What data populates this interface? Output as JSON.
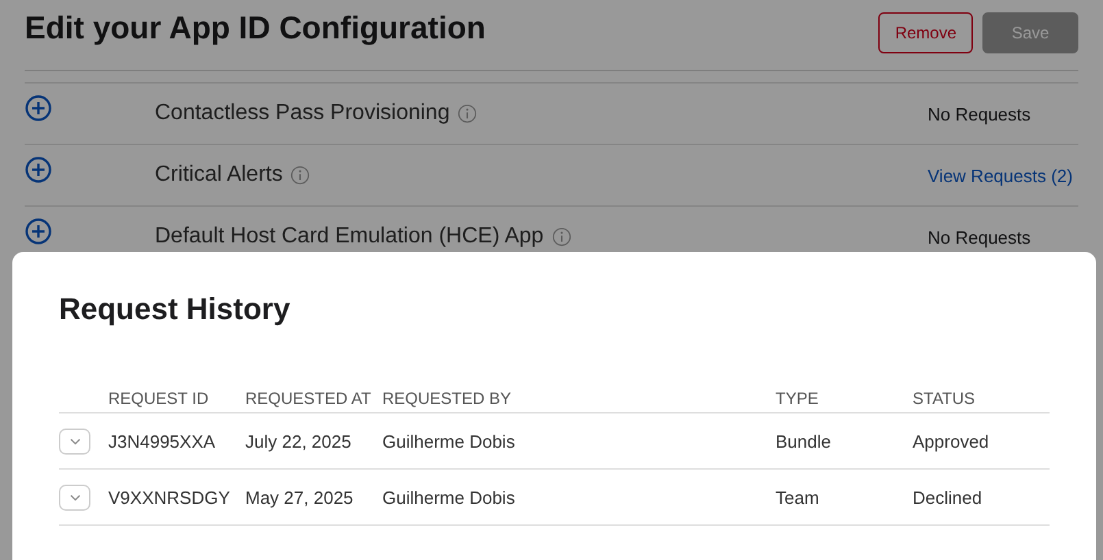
{
  "page": {
    "title": "Edit your App ID Configuration",
    "buttons": [
      {
        "label": "Remove",
        "kind": "destructive"
      },
      {
        "label": "Save",
        "kind": "primary",
        "disabled": true
      }
    ]
  },
  "capabilities": [
    {
      "name": "Contactless Pass Provisioning",
      "requests": "No Requests",
      "kind": "text"
    },
    {
      "name": "Critical Alerts",
      "requests": "View Requests (2)",
      "kind": "link"
    },
    {
      "name": "Default Host Card Emulation (HCE) App",
      "requests": "No Requests",
      "kind": "text"
    }
  ],
  "modal": {
    "title": "Request History",
    "columns": [
      "REQUEST ID",
      "REQUESTED AT",
      "REQUESTED BY",
      "TYPE",
      "STATUS"
    ],
    "rows": [
      {
        "id": "J3N4995XXA",
        "at": "July 22, 2025",
        "by": "Guilherme Dobis",
        "type": "Bundle",
        "status": "Approved"
      },
      {
        "id": "V9XXNRSDGY",
        "at": "May 27, 2025",
        "by": "Guilherme Dobis",
        "type": "Team",
        "status": "Declined"
      }
    ]
  }
}
